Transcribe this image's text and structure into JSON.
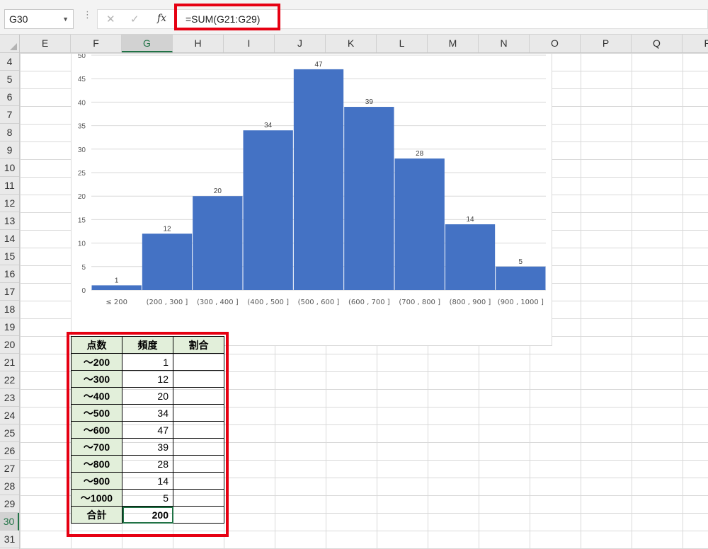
{
  "formula_bar": {
    "name_box": "G30",
    "formula": "=SUM(G21:G29)"
  },
  "columns": [
    "E",
    "F",
    "G",
    "H",
    "I",
    "J",
    "K",
    "L",
    "M",
    "N",
    "O",
    "P",
    "Q",
    "R"
  ],
  "selected_column": "G",
  "rows": [
    "4",
    "5",
    "6",
    "7",
    "8",
    "9",
    "10",
    "11",
    "12",
    "13",
    "14",
    "15",
    "16",
    "17",
    "18",
    "19",
    "20",
    "21",
    "22",
    "23",
    "24",
    "25",
    "26",
    "27",
    "28",
    "29",
    "30",
    "31"
  ],
  "selected_row": "30",
  "chart_data": {
    "type": "bar",
    "categories": [
      "≤ 200",
      "(200 , 300 ]",
      "(300 , 400 ]",
      "(400 , 500 ]",
      "(500 , 600 ]",
      "(600 , 700 ]",
      "(700 , 800 ]",
      "(800 , 900 ]",
      "(900 , 1000 ]"
    ],
    "values": [
      1,
      12,
      20,
      34,
      47,
      39,
      28,
      14,
      5
    ],
    "yticks": [
      "0",
      "5",
      "10",
      "15",
      "20",
      "25",
      "30",
      "35",
      "40",
      "45",
      "50"
    ],
    "ylim": [
      0,
      50
    ],
    "grid": true,
    "bar_color": "#4472c4"
  },
  "table": {
    "headers": [
      "点数",
      "頻度",
      "割合"
    ],
    "rows": [
      {
        "label": "～200",
        "freq": "1",
        "ratio": ""
      },
      {
        "label": "～300",
        "freq": "12",
        "ratio": ""
      },
      {
        "label": "～400",
        "freq": "20",
        "ratio": ""
      },
      {
        "label": "～500",
        "freq": "34",
        "ratio": ""
      },
      {
        "label": "～600",
        "freq": "47",
        "ratio": ""
      },
      {
        "label": "～700",
        "freq": "39",
        "ratio": ""
      },
      {
        "label": "～800",
        "freq": "28",
        "ratio": ""
      },
      {
        "label": "～900",
        "freq": "14",
        "ratio": ""
      },
      {
        "label": "～1000",
        "freq": "5",
        "ratio": ""
      }
    ],
    "total": {
      "label": "合計",
      "freq": "200",
      "ratio": ""
    }
  },
  "colors": {
    "highlight": "#e60012",
    "header_fill": "#e2efda",
    "selection": "#217346"
  }
}
